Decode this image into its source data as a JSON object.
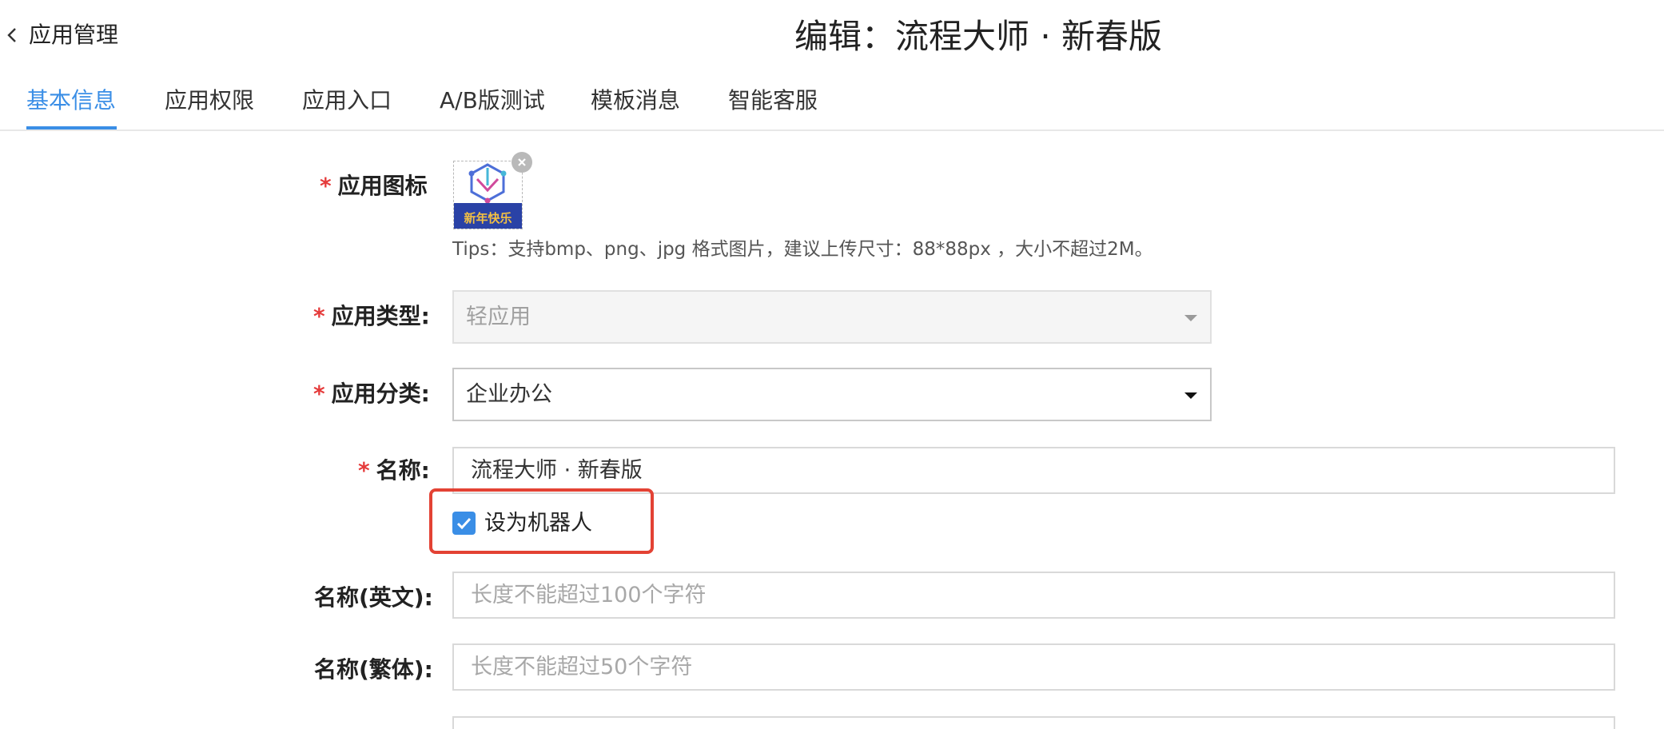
{
  "header": {
    "back_label": "应用管理",
    "title": "编辑：流程大师 · 新春版"
  },
  "tabs": [
    {
      "label": "基本信息",
      "active": true
    },
    {
      "label": "应用权限",
      "active": false
    },
    {
      "label": "应用入口",
      "active": false
    },
    {
      "label": "A/B版测试",
      "active": false
    },
    {
      "label": "模板消息",
      "active": false
    },
    {
      "label": "智能客服",
      "active": false
    }
  ],
  "form": {
    "required_mark": "*",
    "app_icon": {
      "label": "应用图标",
      "logo_text": "新年快乐",
      "tips": "Tips：支持bmp、png、jpg 格式图片，建议上传尺寸：88*88px ，大小不超过2M。"
    },
    "app_type": {
      "label": "应用类型:",
      "value": "轻应用",
      "disabled": true
    },
    "app_category": {
      "label": "应用分类:",
      "value": "企业办公"
    },
    "name": {
      "label": "名称:",
      "value": "流程大师 · 新春版"
    },
    "robot_checkbox": {
      "label": "设为机器人",
      "checked": true
    },
    "name_en": {
      "label": "名称(英文):",
      "placeholder": "长度不能超过100个字符"
    },
    "name_tw": {
      "label": "名称(繁体):",
      "placeholder": "长度不能超过50个字符"
    }
  },
  "colors": {
    "accent": "#3a8ee6",
    "required": "#e53b3b",
    "highlight_border": "#e34234"
  }
}
